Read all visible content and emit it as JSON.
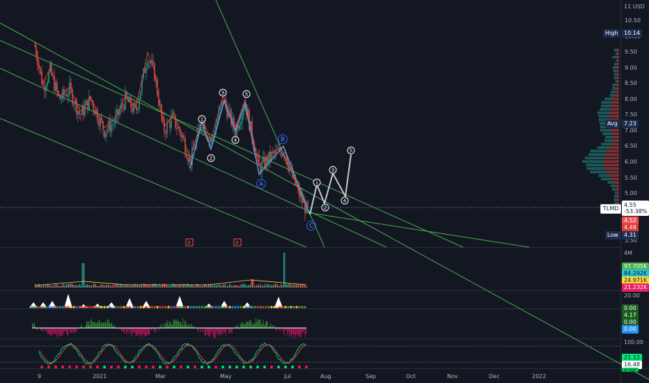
{
  "symbol": "TLMD",
  "currency": "11 USD",
  "colors": {
    "background": "#131722",
    "up": "#26a69a",
    "down": "#ef5350",
    "channel": "#4caf50",
    "ma": "#e53935",
    "wave_projection": "#c9c9c9",
    "abc_label": "#2962ff"
  },
  "main_axis": {
    "ticks": [
      "10.50",
      "10.00",
      "9.50",
      "9.00",
      "8.50",
      "8.00",
      "7.50",
      "7.00",
      "6.50",
      "6.00",
      "5.50",
      "5.00",
      "3.50"
    ],
    "tick_values": [
      10.5,
      10.0,
      9.5,
      9.0,
      8.5,
      8.0,
      7.5,
      7.0,
      6.5,
      6.0,
      5.5,
      5.0,
      3.5
    ]
  },
  "price_tags": {
    "high_label": "High",
    "high_value": "10.14",
    "avg_label": "Avg",
    "avg_value": "7.23",
    "last_symbol": "TLMD",
    "last_value": "4.55",
    "last_change": "-53.38%",
    "tag_a": "4.52",
    "tag_b": "4.48",
    "low_label": "Low",
    "low_value": "4.31"
  },
  "time_axis": [
    "9",
    "2021",
    "Mar",
    "May",
    "Jul",
    "Aug",
    "Sep",
    "Oct",
    "Nov",
    "Dec",
    "2022"
  ],
  "wave_labels": {
    "impulse_1": [
      "1",
      "2",
      "3",
      "4",
      "5"
    ],
    "abc": [
      "A",
      "B",
      "C"
    ],
    "projection": [
      "1",
      "2",
      "3",
      "4",
      "5"
    ],
    "earnings": [
      "E",
      "E"
    ]
  },
  "volume_panel": {
    "scale_top": "4M",
    "values": [
      "97.705K",
      "84.292K",
      "24.971K",
      "21.232K"
    ]
  },
  "panel3": {
    "value": "20.00",
    "last": "0.00"
  },
  "panel4": {
    "values": [
      "4.17",
      "0.00",
      "0.00"
    ]
  },
  "panel5": {
    "scale_top": "100.00",
    "values": [
      "21.12",
      "16.48",
      "0.00"
    ]
  }
}
